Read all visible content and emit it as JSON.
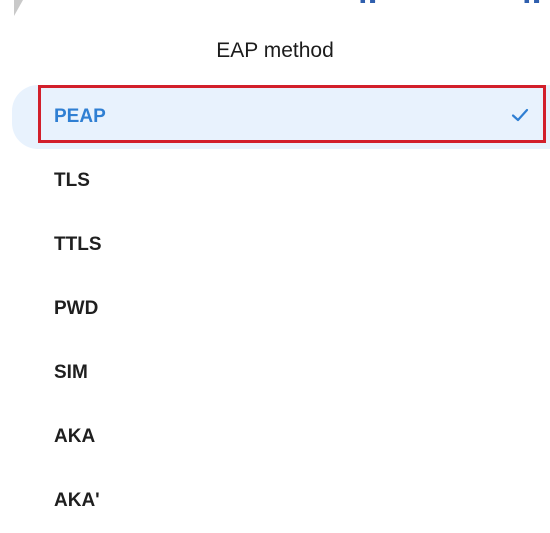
{
  "dialog": {
    "title": "EAP method",
    "options": [
      {
        "label": "PEAP",
        "selected": true
      },
      {
        "label": "TLS",
        "selected": false
      },
      {
        "label": "TTLS",
        "selected": false
      },
      {
        "label": "PWD",
        "selected": false
      },
      {
        "label": "SIM",
        "selected": false
      },
      {
        "label": "AKA",
        "selected": false
      },
      {
        "label": "AKA'",
        "selected": false
      }
    ],
    "selected_icon": "checkmark-icon"
  },
  "top_fragment": {
    "left_text": "p",
    "right_text": "p"
  },
  "colors": {
    "accent": "#2f7fd3",
    "selected_background": "#e8f2fd",
    "highlight_border": "#d21f2b",
    "text": "#1f1f1f"
  }
}
